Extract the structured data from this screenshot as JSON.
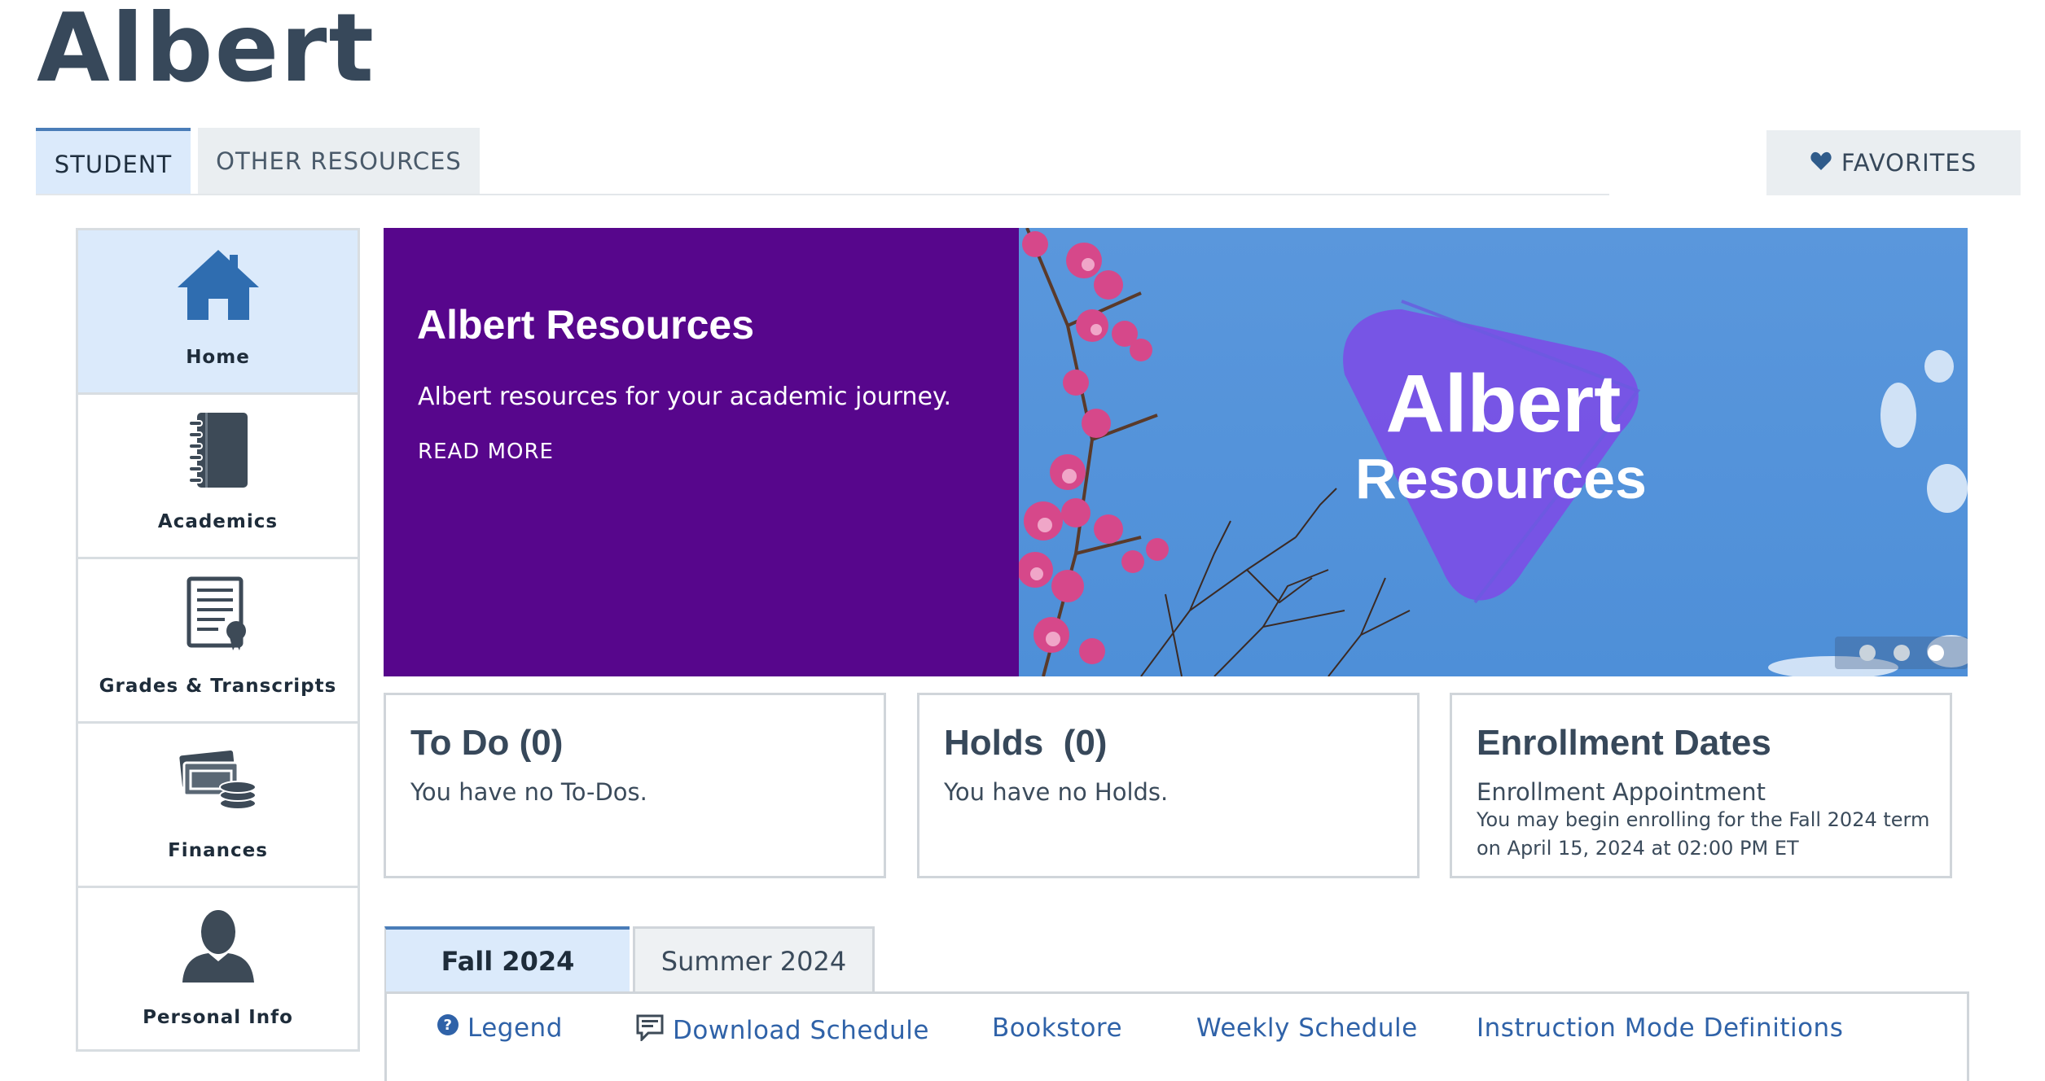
{
  "app": {
    "title": "Albert"
  },
  "top_tabs": {
    "student": "STUDENT",
    "other": "OTHER RESOURCES",
    "favorites": "FAVORITES"
  },
  "nav": {
    "items": [
      {
        "label": "Home",
        "icon": "home-icon"
      },
      {
        "label": "Academics",
        "icon": "notebook-icon"
      },
      {
        "label": "Grades & Transcripts",
        "icon": "transcript-icon"
      },
      {
        "label": "Finances",
        "icon": "money-icon"
      },
      {
        "label": "Personal Info",
        "icon": "person-icon"
      }
    ]
  },
  "banner": {
    "title": "Albert Resources",
    "description": "Albert resources for your academic journey.",
    "read_more": "READ MORE",
    "image_text_line1": "Albert",
    "image_text_line2": "Resources",
    "slides": 3,
    "active_slide": 3
  },
  "cards": {
    "todo": {
      "title": "To Do (0)",
      "text": "You have no To-Dos."
    },
    "holds": {
      "title": "Holds  (0)",
      "text": "You have no Holds."
    },
    "enrollment": {
      "title": "Enrollment Dates",
      "subtitle": "Enrollment Appointment",
      "detail": "You may begin enrolling for the Fall 2024 term on April 15, 2024 at 02:00 PM ET"
    }
  },
  "terms": {
    "tabs": [
      "Fall 2024",
      "Summer 2024"
    ],
    "links": [
      "Legend",
      "Download Schedule",
      "Bookstore",
      "Weekly Schedule",
      "Instruction Mode Definitions"
    ]
  },
  "colors": {
    "accent_purple": "#57068c",
    "active_tab_bg": "#dbeafb",
    "link": "#2f62a8",
    "sky": "#5a97dc"
  }
}
